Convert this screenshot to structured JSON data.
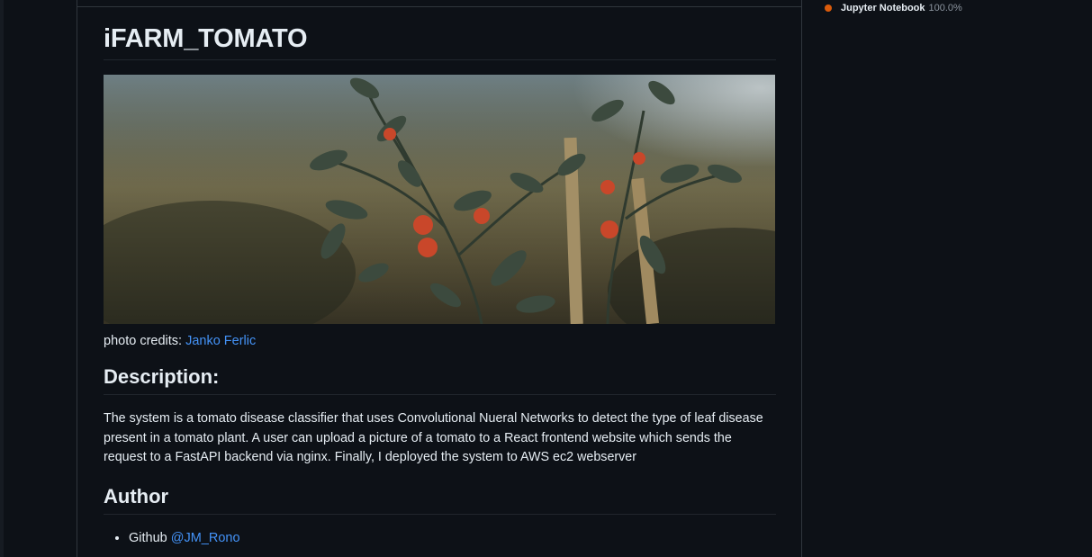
{
  "readme": {
    "title": "iFARM_TOMATO",
    "credits_prefix": "photo credits: ",
    "credits_author": "Janko Ferlic",
    "description_heading": "Description:",
    "description_text": "The system is a tomato disease classifier that uses Convolutional Nueral Networks to detect the type of leaf disease present in a tomato plant. A user can upload a picture of a tomato to a React frontend website which sends the request to a FastAPI backend via nginx. Finally, I deployed the system to AWS ec2 webserver",
    "author_heading": "Author",
    "author_items": [
      {
        "label": "Github ",
        "handle": "@JM_Rono"
      }
    ]
  },
  "sidebar": {
    "languages": [
      {
        "name": "Jupyter Notebook",
        "percent": "100.0%",
        "color": "#da5b0b"
      }
    ]
  },
  "colors": {
    "background": "#0d1117",
    "link": "#4493f8",
    "border": "#30363d",
    "text": "#e6edf3",
    "muted": "#8b949e"
  }
}
